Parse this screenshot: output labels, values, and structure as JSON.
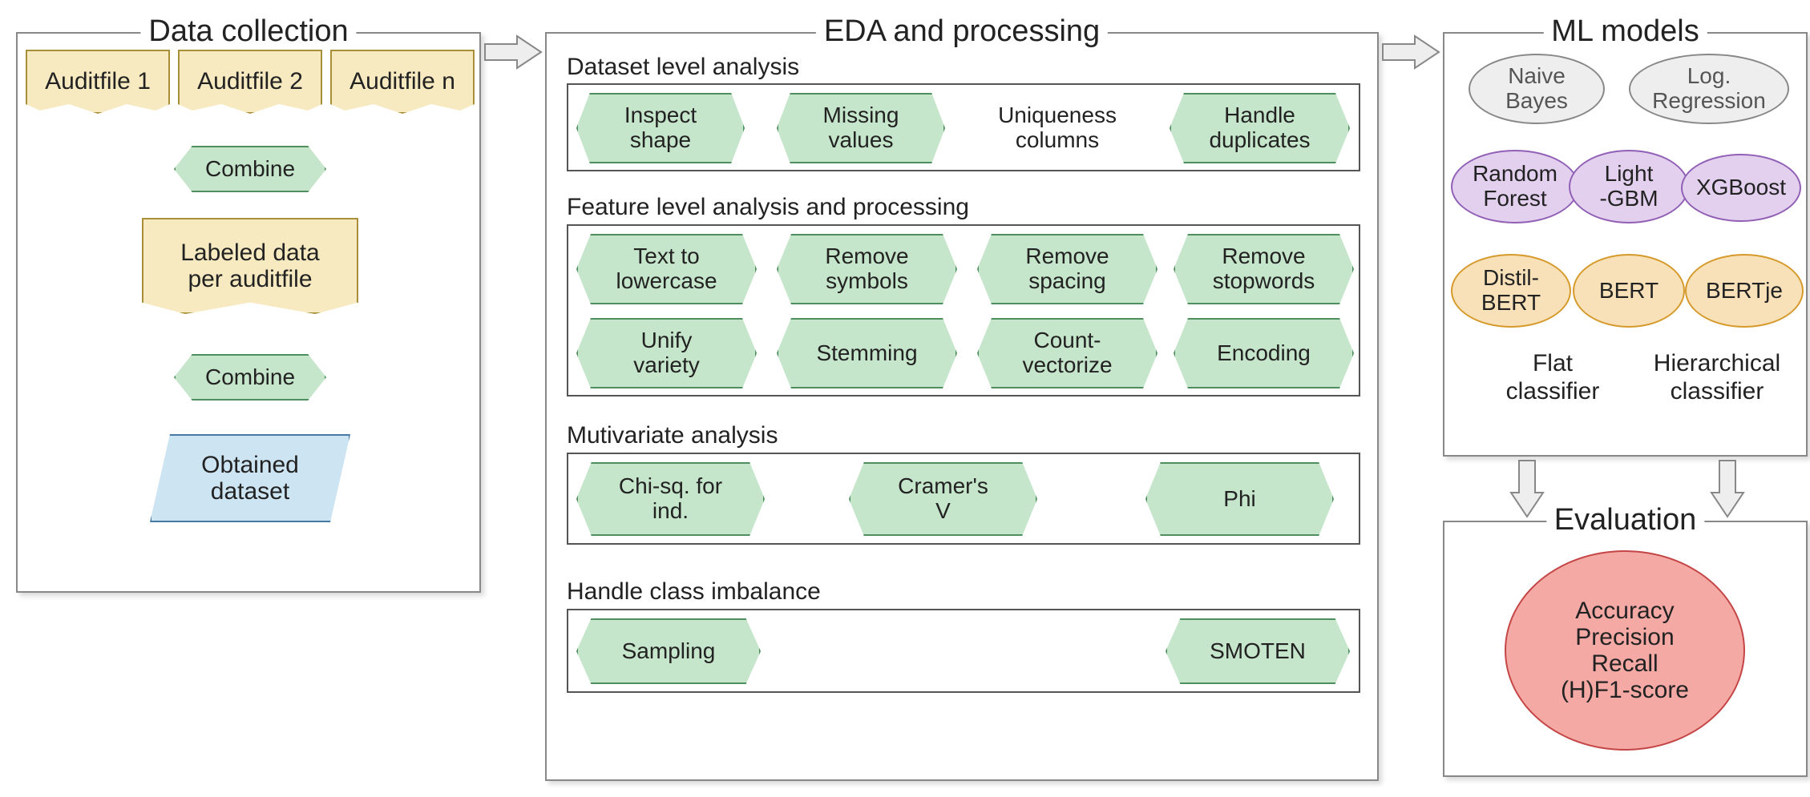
{
  "panels": {
    "data_collection": {
      "title": "Data collection"
    },
    "eda": {
      "title": "EDA and processing"
    },
    "ml": {
      "title": "ML models"
    },
    "eval": {
      "title": "Evaluation"
    }
  },
  "data_collection": {
    "files": [
      "Auditfile 1",
      "Auditfile 2",
      "Auditfile n"
    ],
    "combine1": "Combine",
    "labeled": "Labeled data\nper auditfile",
    "combine2": "Combine",
    "obtained": "Obtained\ndataset"
  },
  "eda": {
    "sub1_label": "Dataset level analysis",
    "sub1_items": [
      "Inspect\nshape",
      "Missing\nvalues",
      "Uniqueness\ncolumns",
      "Handle\nduplicates"
    ],
    "sub2_label": "Feature level analysis and processing",
    "sub2_items_row1": [
      "Text to\nlowercase",
      "Remove\nsymbols",
      "Remove\nspacing",
      "Remove\nstopwords"
    ],
    "sub2_items_row2": [
      "Unify\nvariety",
      "Stemming",
      "Count-\nvectorize",
      "Encoding"
    ],
    "sub3_label": "Mutivariate analysis",
    "sub3_items": [
      "Chi-sq. for\nind.",
      "Cramer's\nV",
      "Phi"
    ],
    "sub4_label": "Handle class imbalance",
    "sub4_items": [
      "Sampling",
      "SMOTEN"
    ]
  },
  "ml": {
    "row1": [
      "Naive\nBayes",
      "Log.\nRegression"
    ],
    "row2": [
      "Random\nForest",
      "Light\n-GBM",
      "XGBoost"
    ],
    "row3": [
      "Distil-\nBERT",
      "BERT",
      "BERTje"
    ],
    "col_labels": [
      "Flat\nclassifier",
      "Hierarchical\nclassifier"
    ]
  },
  "eval": {
    "metrics": "Accuracy\nPrecision\nRecall\n(H)F1-score"
  }
}
